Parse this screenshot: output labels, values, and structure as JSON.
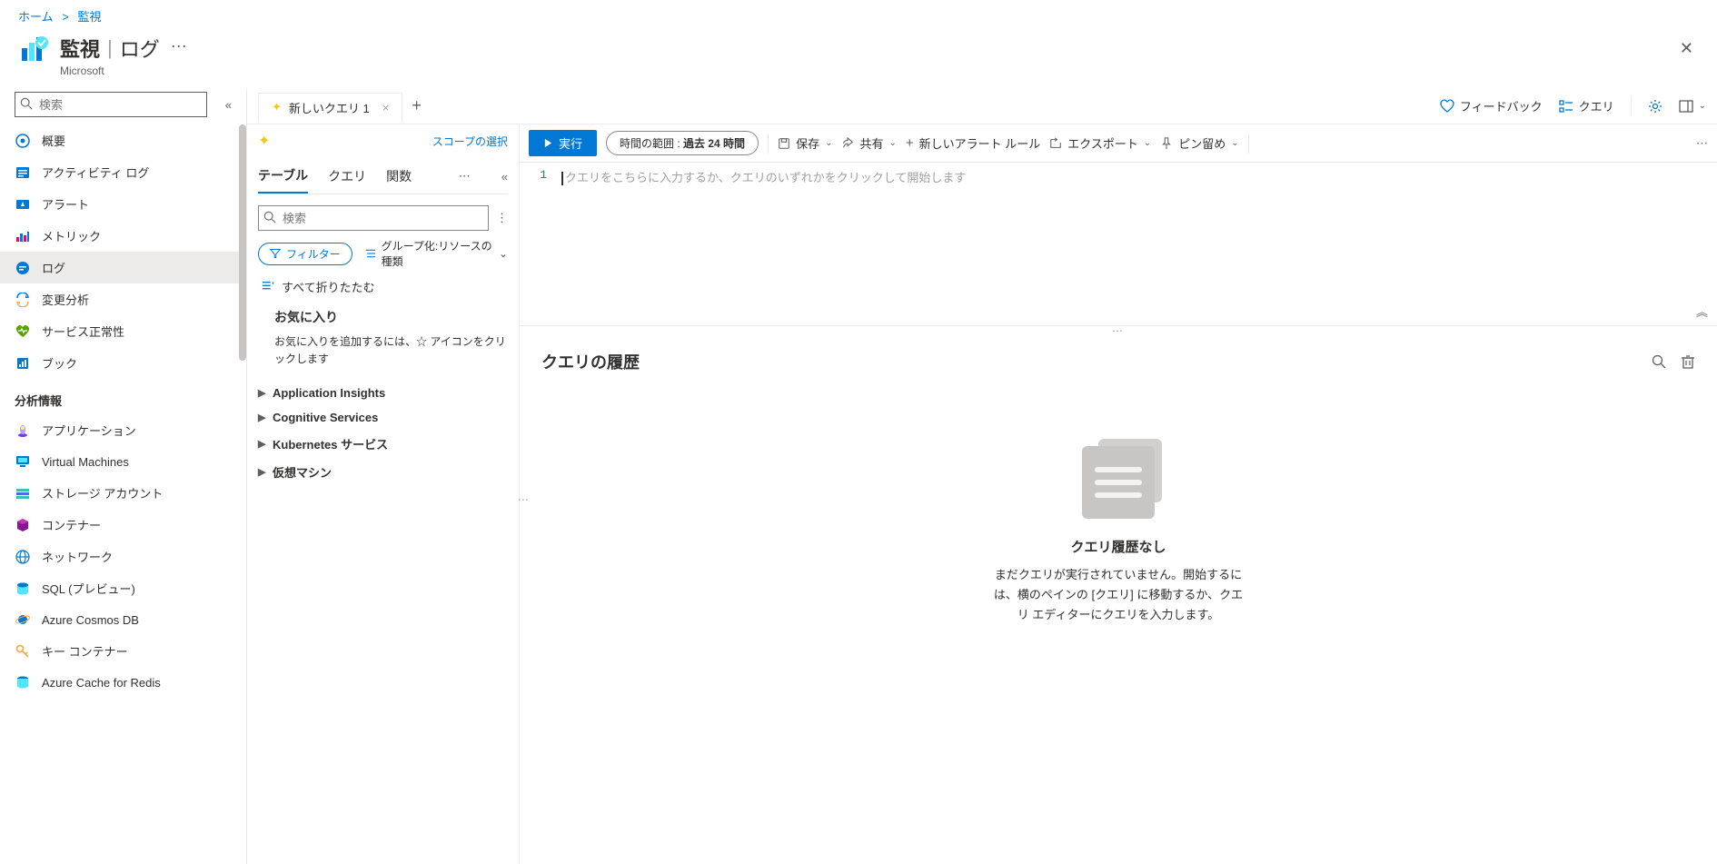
{
  "breadcrumb": {
    "home": "ホーム",
    "current": "監視"
  },
  "header": {
    "title": "監視",
    "subtitle": "ログ",
    "org": "Microsoft"
  },
  "sidebar": {
    "search_placeholder": "検索",
    "items": [
      {
        "label": "概要"
      },
      {
        "label": "アクティビティ ログ"
      },
      {
        "label": "アラート"
      },
      {
        "label": "メトリック"
      },
      {
        "label": "ログ"
      },
      {
        "label": "変更分析"
      },
      {
        "label": "サービス正常性"
      },
      {
        "label": "ブック"
      }
    ],
    "section": "分析情報",
    "insights": [
      {
        "label": "アプリケーション"
      },
      {
        "label": "Virtual Machines"
      },
      {
        "label": "ストレージ アカウント"
      },
      {
        "label": "コンテナー"
      },
      {
        "label": "ネットワーク"
      },
      {
        "label": "SQL (プレビュー)"
      },
      {
        "label": "Azure Cosmos DB"
      },
      {
        "label": "キー コンテナー"
      },
      {
        "label": "Azure Cache for Redis"
      }
    ]
  },
  "tab": {
    "label": "新しいクエリ 1"
  },
  "topbar": {
    "feedback": "フィードバック",
    "queries": "クエリ"
  },
  "tpanel": {
    "scope": "スコープの選択",
    "tabs": {
      "tables": "テーブル",
      "queries": "クエリ",
      "functions": "関数"
    },
    "search_placeholder": "検索",
    "filter": "フィルター",
    "groupby": "グループ化:リソースの種類",
    "collapse_all": "すべて折りたたむ",
    "fav_title": "お気に入り",
    "fav_text": "お気に入りを追加するには、☆ アイコンをクリックします",
    "tree": [
      "Application Insights",
      "Cognitive Services",
      "Kubernetes サービス",
      "仮想マシン"
    ]
  },
  "toolbar": {
    "run": "実行",
    "time_label": "時間の範囲 : ",
    "time_value": "過去 24 時間",
    "save": "保存",
    "share": "共有",
    "new_alert": "新しいアラート ルール",
    "export": "エクスポート",
    "pin": "ピン留め"
  },
  "editor": {
    "line_no": "1",
    "placeholder": "クエリをこちらに入力するか、クエリのいずれかをクリックして開始します"
  },
  "results": {
    "title": "クエリの履歴",
    "empty_title": "クエリ履歴なし",
    "empty_text": "まだクエリが実行されていません。開始するには、横のペインの [クエリ] に移動するか、クエリ エディターにクエリを入力します。"
  }
}
